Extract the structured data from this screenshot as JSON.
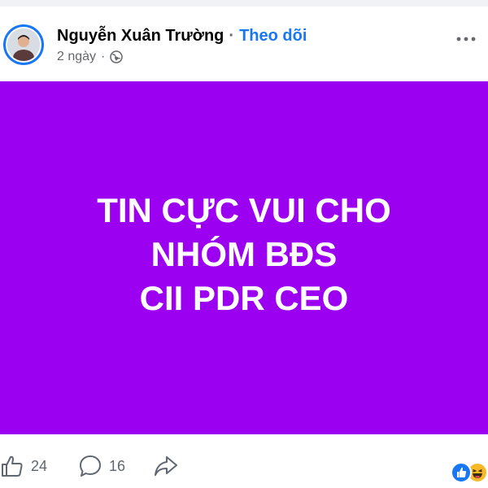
{
  "colors": {
    "accent": "#1877f2",
    "post_background": "#9b00f0",
    "post_text": "#ffffff",
    "secondary_text": "#65676b"
  },
  "post": {
    "author": {
      "name": "Nguyễn Xuân Trường",
      "separator": "·",
      "follow_label": "Theo dõi",
      "avatar_icon": "avatar-photo"
    },
    "meta": {
      "time": "2 ngày",
      "separator": "·",
      "privacy_icon": "globe-icon"
    },
    "more_icon": "more-horizontal-icon",
    "content": {
      "lines": [
        "TIN CỰC VUI CHO",
        "NHÓM BĐS",
        "CII PDR CEO"
      ]
    },
    "actions": {
      "like": {
        "icon": "thumbs-up-icon",
        "count": "24"
      },
      "comment": {
        "icon": "comment-icon",
        "count": "16"
      },
      "share": {
        "icon": "share-icon"
      }
    },
    "reactions": [
      "like-reaction-icon",
      "haha-reaction-icon"
    ]
  }
}
